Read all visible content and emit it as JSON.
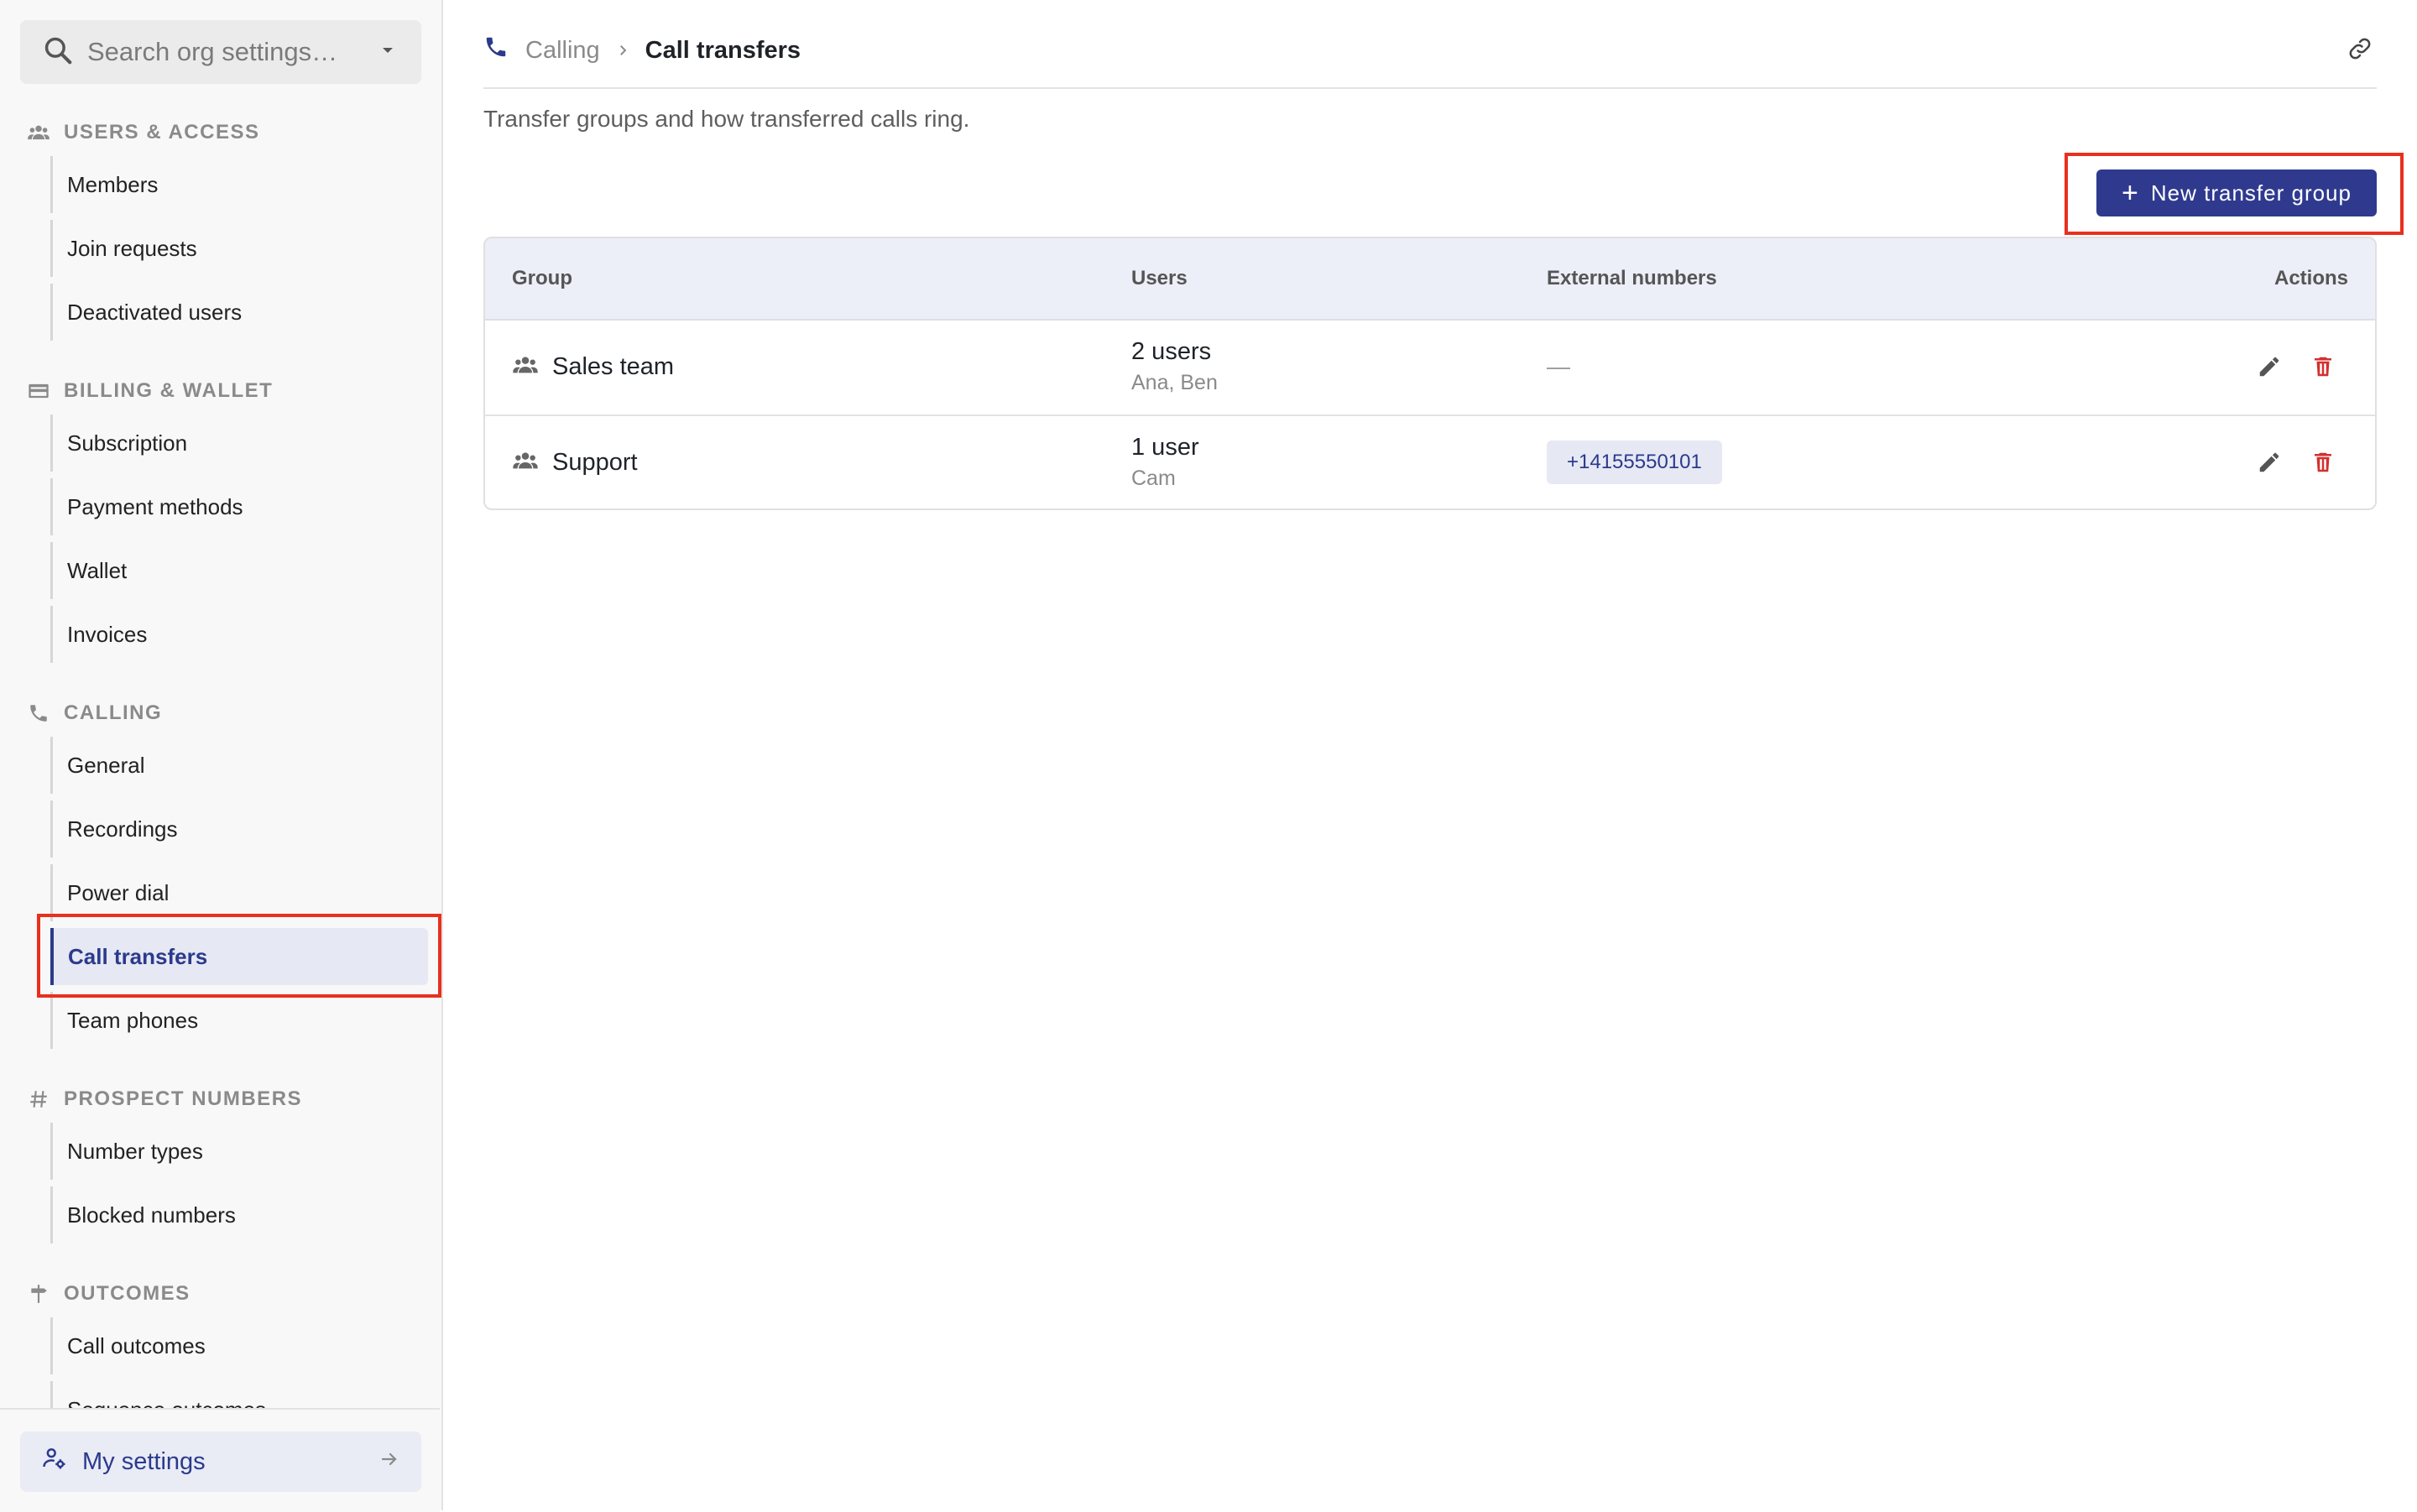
{
  "search": {
    "placeholder": "Search org settings…"
  },
  "sidebar": {
    "sections": [
      {
        "title": "USERS & ACCESS",
        "icon": "people-icon",
        "items": [
          "Members",
          "Join requests",
          "Deactivated users"
        ]
      },
      {
        "title": "BILLING & WALLET",
        "icon": "credit-card-icon",
        "items": [
          "Subscription",
          "Payment methods",
          "Wallet",
          "Invoices"
        ]
      },
      {
        "title": "CALLING",
        "icon": "phone-icon",
        "items": [
          "General",
          "Recordings",
          "Power dial",
          "Call transfers",
          "Team phones"
        ]
      },
      {
        "title": "PROSPECT NUMBERS",
        "icon": "hash-icon",
        "items": [
          "Number types",
          "Blocked numbers"
        ]
      },
      {
        "title": "OUTCOMES",
        "icon": "signpost-icon",
        "items": [
          "Call outcomes",
          "Sequence outcomes"
        ]
      }
    ],
    "active_item": "Call transfers",
    "footer": {
      "label": "My settings"
    }
  },
  "breadcrumb": {
    "parent": "Calling",
    "current": "Call transfers"
  },
  "page": {
    "subtitle": "Transfer groups and how transferred calls ring.",
    "new_button_label": "New transfer group"
  },
  "table": {
    "headers": {
      "group": "Group",
      "users": "Users",
      "external": "External numbers",
      "actions": "Actions"
    },
    "rows": [
      {
        "group": "Sales team",
        "users_count": "2 users",
        "users_names": "Ana, Ben",
        "external": "—"
      },
      {
        "group": "Support",
        "users_count": "1 user",
        "users_names": "Cam",
        "external": "+14155550101"
      }
    ]
  },
  "colors": {
    "accent": "#2f3a8f",
    "highlight": "#e8301f",
    "danger": "#d32f2f",
    "active_bg": "#e6e8f4"
  }
}
